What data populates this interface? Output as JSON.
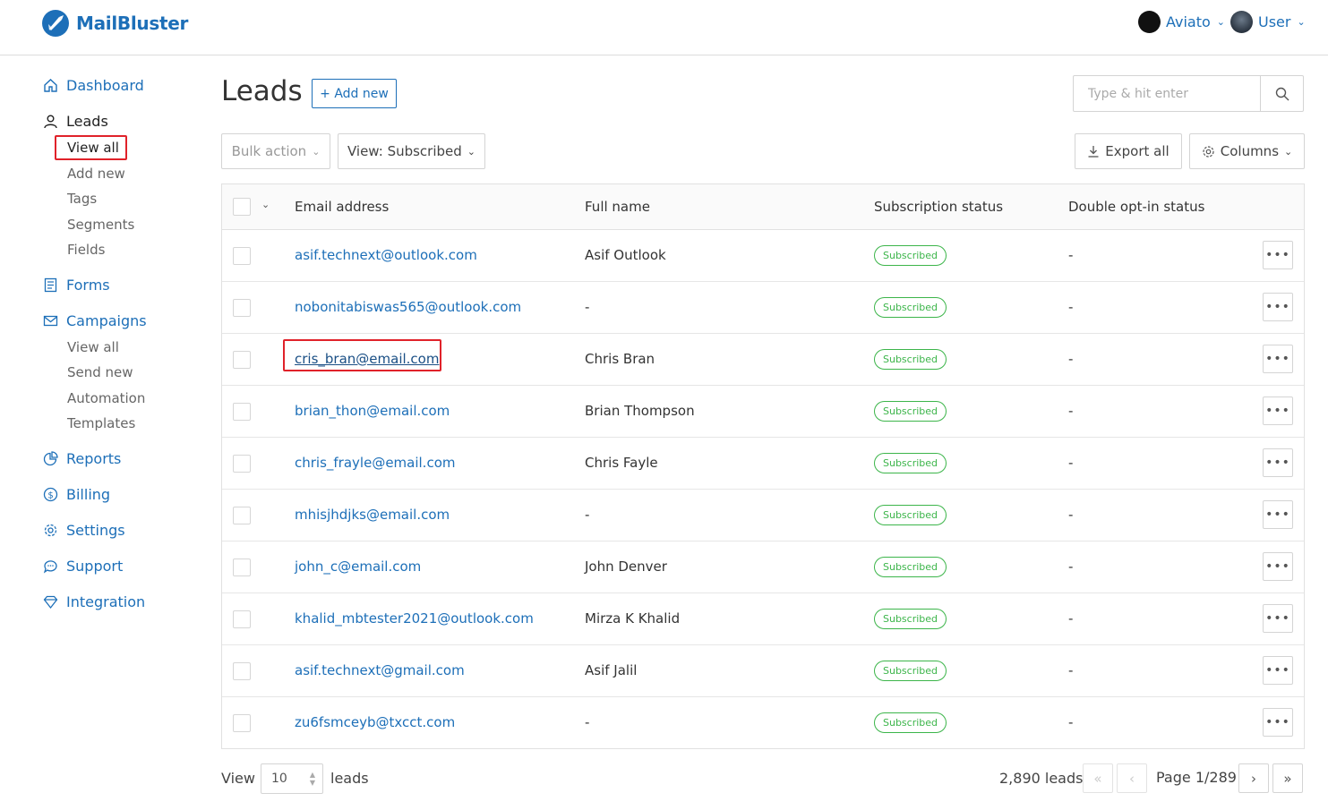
{
  "brand": {
    "name": "MailBluster"
  },
  "header": {
    "org_menu": "Aviato",
    "user_menu": "User"
  },
  "sidebar": {
    "dashboard": "Dashboard",
    "leads": "Leads",
    "leads_sub": [
      "View all",
      "Add new",
      "Tags",
      "Segments",
      "Fields"
    ],
    "forms": "Forms",
    "campaigns": "Campaigns",
    "campaigns_sub": [
      "View all",
      "Send new",
      "Automation",
      "Templates"
    ],
    "reports": "Reports",
    "billing": "Billing",
    "settings": "Settings",
    "support": "Support",
    "integration": "Integration"
  },
  "main": {
    "title": "Leads",
    "add_new": "+ Add new",
    "search_placeholder": "Type & hit enter",
    "bulk_action": "Bulk action",
    "view_filter": "View: Subscribed",
    "export_all": "Export all",
    "columns": "Columns"
  },
  "table": {
    "headers": [
      "Email address",
      "Full name",
      "Subscription status",
      "Double opt-in status"
    ],
    "rows": [
      {
        "email": "asif.technext@outlook.com",
        "name": "Asif Outlook",
        "status": "Subscribed",
        "double_optin": "-"
      },
      {
        "email": "nobonitabiswas565@outlook.com",
        "name": "-",
        "status": "Subscribed",
        "double_optin": "-"
      },
      {
        "email": "cris_bran@email.com",
        "name": "Chris Bran",
        "status": "Subscribed",
        "double_optin": "-"
      },
      {
        "email": "brian_thon@email.com",
        "name": "Brian Thompson",
        "status": "Subscribed",
        "double_optin": "-"
      },
      {
        "email": "chris_frayle@email.com",
        "name": "Chris Fayle",
        "status": "Subscribed",
        "double_optin": "-"
      },
      {
        "email": "mhisjhdjks@email.com",
        "name": "-",
        "status": "Subscribed",
        "double_optin": "-"
      },
      {
        "email": "john_c@email.com",
        "name": "John Denver",
        "status": "Subscribed",
        "double_optin": "-"
      },
      {
        "email": "khalid_mbtester2021@outlook.com",
        "name": "Mirza K Khalid",
        "status": "Subscribed",
        "double_optin": "-"
      },
      {
        "email": "asif.technext@gmail.com",
        "name": "Asif Jalil",
        "status": "Subscribed",
        "double_optin": "-"
      },
      {
        "email": "zu6fsmceyb@txcct.com",
        "name": "-",
        "status": "Subscribed",
        "double_optin": "-"
      }
    ]
  },
  "footer": {
    "view_label": "View",
    "per_page": "10",
    "leads_label": "leads",
    "total": "2,890 leads",
    "page": "Page 1/289"
  },
  "colors": {
    "accent": "#1d6fb8",
    "subscribed": "#3cb54a",
    "highlight": "#e0222a"
  }
}
